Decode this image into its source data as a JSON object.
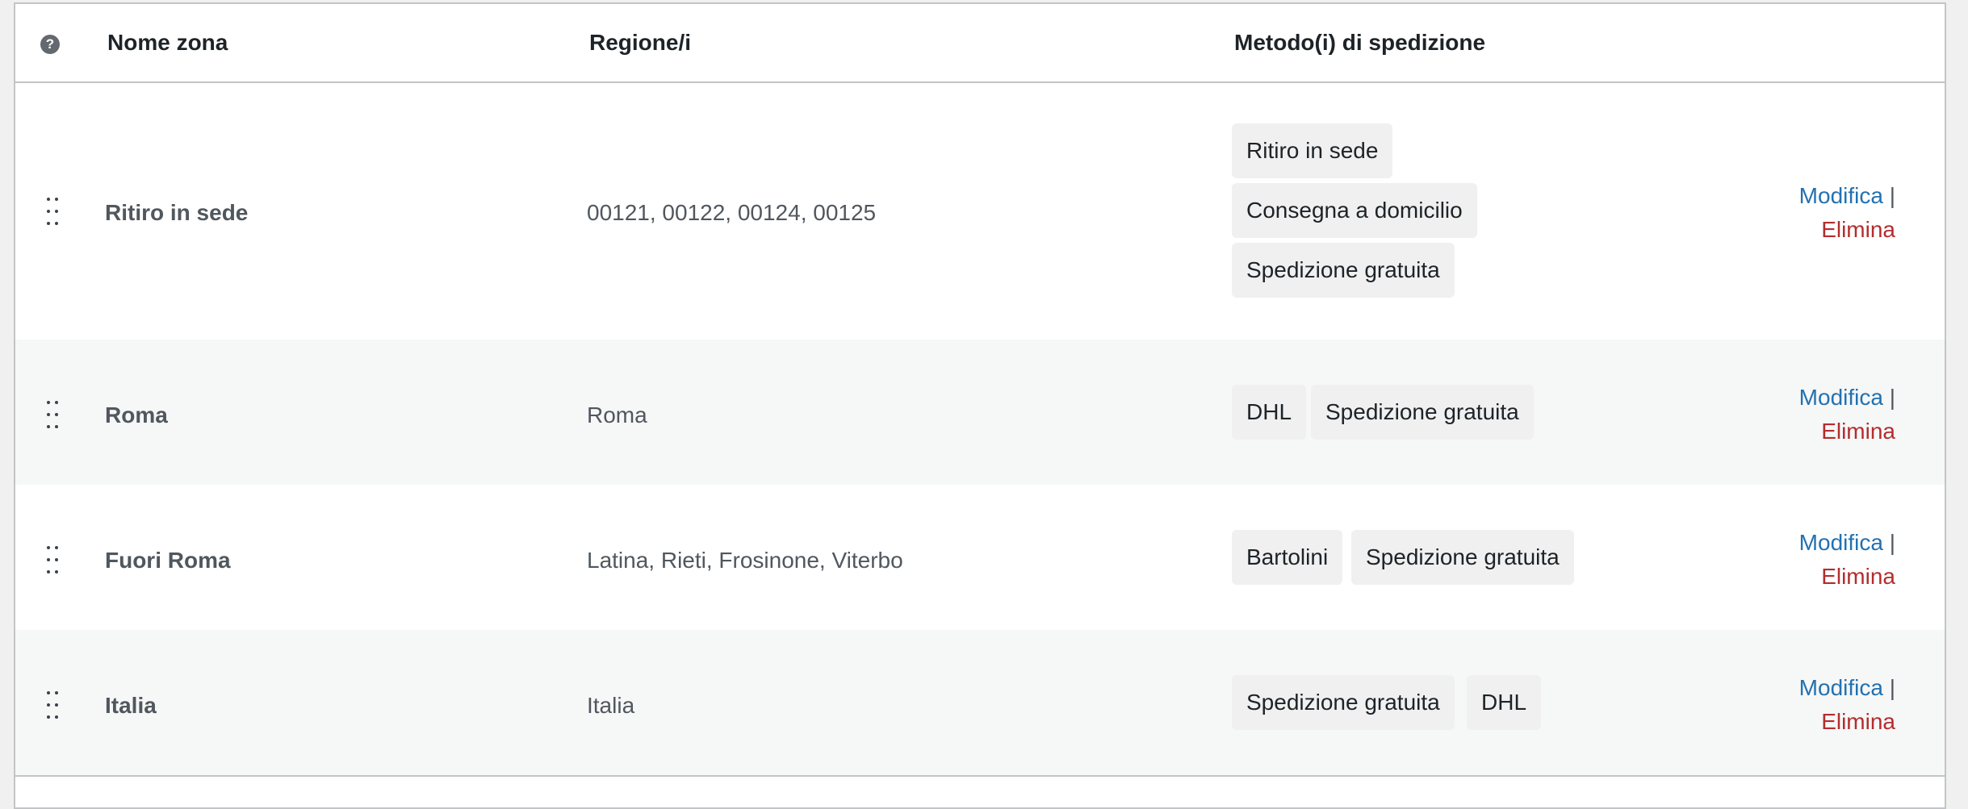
{
  "table": {
    "headers": {
      "help_icon": "?",
      "zone_name": "Nome zona",
      "regions": "Regione/i",
      "methods": "Metodo(i) di spedizione"
    },
    "actions": {
      "edit_label": "Modifica",
      "separator": "|",
      "delete_label": "Elimina"
    },
    "rows": [
      {
        "name": "Ritiro in sede",
        "regions": "00121, 00122, 00124, 00125",
        "methods": [
          "Ritiro in sede",
          "Consegna a domicilio",
          "Spedizione gratuita"
        ]
      },
      {
        "name": "Roma",
        "regions": "Roma",
        "methods": [
          "DHL",
          "Spedizione gratuita"
        ]
      },
      {
        "name": "Fuori Roma",
        "regions": "Latina, Rieti, Frosinone, Viterbo",
        "methods": [
          "Bartolini",
          "Spedizione gratuita"
        ]
      },
      {
        "name": "Italia",
        "regions": "Italia",
        "methods": [
          "Spedizione gratuita",
          "DHL"
        ]
      }
    ]
  },
  "colors": {
    "link": "#2271b1",
    "delete": "#b32d2e",
    "row_alt_bg": "#f6f7f7",
    "method_bg": "#f0f0f0",
    "border": "#c3c4c7"
  },
  "icons": {
    "help": "help-circle-icon",
    "drag": "drag-handle-icon"
  }
}
